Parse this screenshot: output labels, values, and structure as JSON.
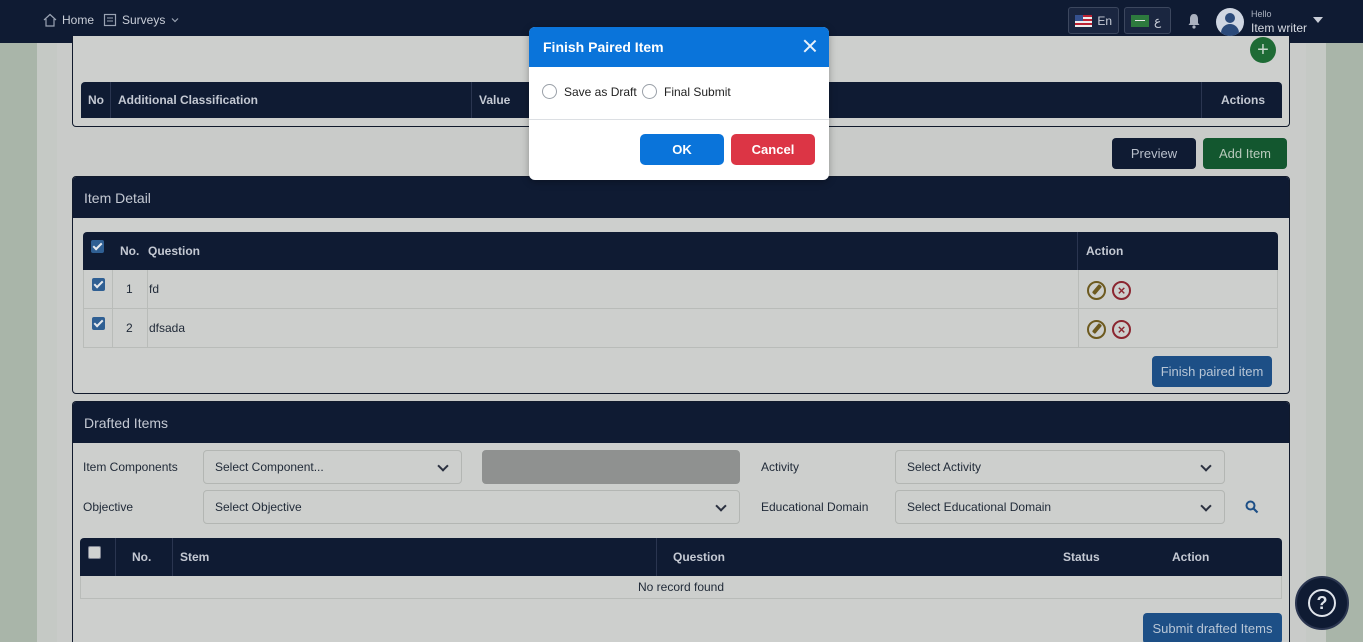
{
  "navbar": {
    "home_label": "Home",
    "surveys_label": "Surveys",
    "lang_en": "En",
    "lang_ar": "ع",
    "user_greeting": "Hello",
    "user_name": "Item writer"
  },
  "classification_table": {
    "columns": [
      "No",
      "Additional Classification",
      "Value",
      "Actions"
    ]
  },
  "item_actions": {
    "preview_label": "Preview",
    "add_item_label": "Add Item"
  },
  "item_detail": {
    "title": "Item Detail",
    "columns": [
      "No.",
      "Question",
      "Action"
    ],
    "rows": [
      {
        "no": "1",
        "question": "fd"
      },
      {
        "no": "2",
        "question": "dfsada"
      }
    ],
    "finish_label": "Finish paired item"
  },
  "drafted": {
    "title": "Drafted Items",
    "filters": {
      "components_label": "Item Components",
      "components_placeholder": "Select Component...",
      "activity_label": "Activity",
      "activity_placeholder": "Select Activity",
      "objective_label": "Objective",
      "objective_placeholder": "Select Objective",
      "domain_label": "Educational Domain",
      "domain_placeholder": "Select Educational Domain"
    },
    "columns": [
      "No.",
      "Stem",
      "Question",
      "Status",
      "Action"
    ],
    "empty_text": "No record found",
    "submit_label": "Submit drafted Items"
  },
  "modal": {
    "title": "Finish Paired Item",
    "option_draft": "Save as Draft",
    "option_final": "Final Submit",
    "ok_label": "OK",
    "cancel_label": "Cancel"
  },
  "colors": {
    "navy": "#0f1b33",
    "modal_blue": "#0a74da",
    "cancel_red": "#dc3545",
    "add_green": "#13572f"
  }
}
